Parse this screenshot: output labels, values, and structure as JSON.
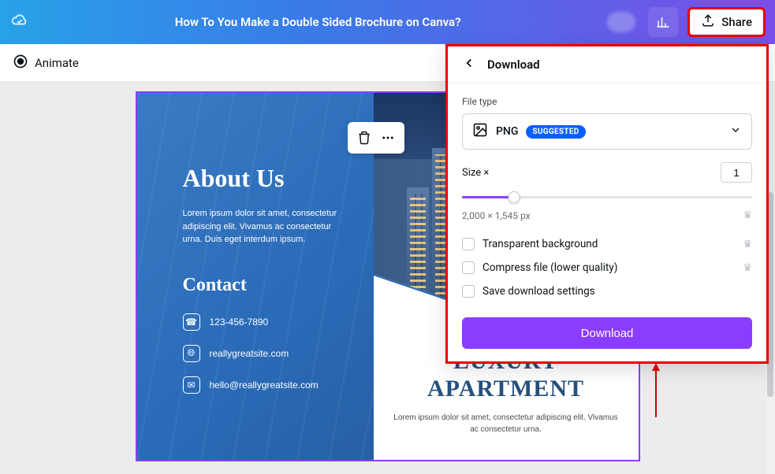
{
  "header": {
    "title": "How To You Make a Double Sided Brochure on Canva?",
    "share_label": "Share"
  },
  "toolbar": {
    "animate_label": "Animate"
  },
  "design": {
    "about_heading": "About Us",
    "about_body": "Lorem ipsum dolor sit amet, consectetur adipiscing elit. Vivamus ac consectetur urna. Duis eget interdum ipsum.",
    "contact_heading": "Contact",
    "contact_phone": "123-456-7890",
    "contact_site": "reallygreatsite.com",
    "contact_email": "hello@reallygreatsite.com",
    "luxury_line1": "LUXURY",
    "luxury_line2": "APARTMENT",
    "luxury_body": "Lorem ipsum dolor sit amet, consectetur adipiscing elit. Vivamus ac consectetur urna."
  },
  "panel": {
    "title": "Download",
    "filetype_label": "File type",
    "filetype_value": "PNG",
    "suggested_badge": "SUGGESTED",
    "size_label": "Size ×",
    "size_value": "1",
    "dimensions": "2,000 × 1,545 px",
    "opt_transparent": "Transparent background",
    "opt_compress": "Compress file (lower quality)",
    "opt_save": "Save download settings",
    "download_btn": "Download"
  }
}
